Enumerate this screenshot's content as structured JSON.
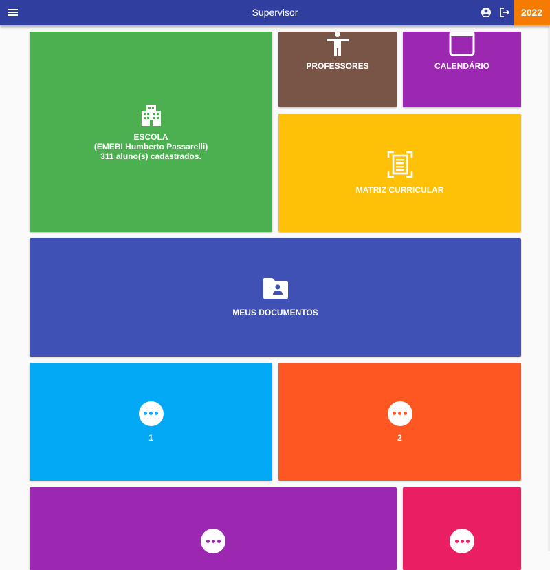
{
  "header": {
    "title": "Supervisor",
    "year": "2022",
    "menu_icon": "menu-icon",
    "account_icon": "account-circle-icon",
    "logout_icon": "logout-icon",
    "bar_color": "#303f9f",
    "year_color": "#f57c00"
  },
  "tiles": {
    "escola": {
      "label": "ESCOLA\n(EMEBI Humberto Passarelli)\n311 aluno(s) cadastrados.",
      "icon": "building-icon",
      "color": "#4caf50"
    },
    "professores": {
      "label": "PROFESSORES",
      "icon": "person-icon",
      "color": "#795548"
    },
    "calendario": {
      "label": "CALENDÁRIO",
      "icon": "calendar-icon",
      "color": "#9c27b0"
    },
    "matriz": {
      "label": "MATRIZ CURRICULAR",
      "icon": "document-scan-icon",
      "color": "#ffc107"
    },
    "documentos": {
      "label": "MEUS DOCUMENTOS",
      "icon": "folder-account-icon",
      "color": "#3f51b5"
    },
    "tile1": {
      "label": "1",
      "icon": "more-icon",
      "color": "#03a9f4"
    },
    "tile2": {
      "label": "2",
      "icon": "more-icon",
      "color": "#ff5722"
    },
    "tile3": {
      "icon": "more-icon",
      "color": "#9c27b0"
    },
    "tile4": {
      "icon": "more-icon",
      "color": "#e91e63"
    }
  }
}
